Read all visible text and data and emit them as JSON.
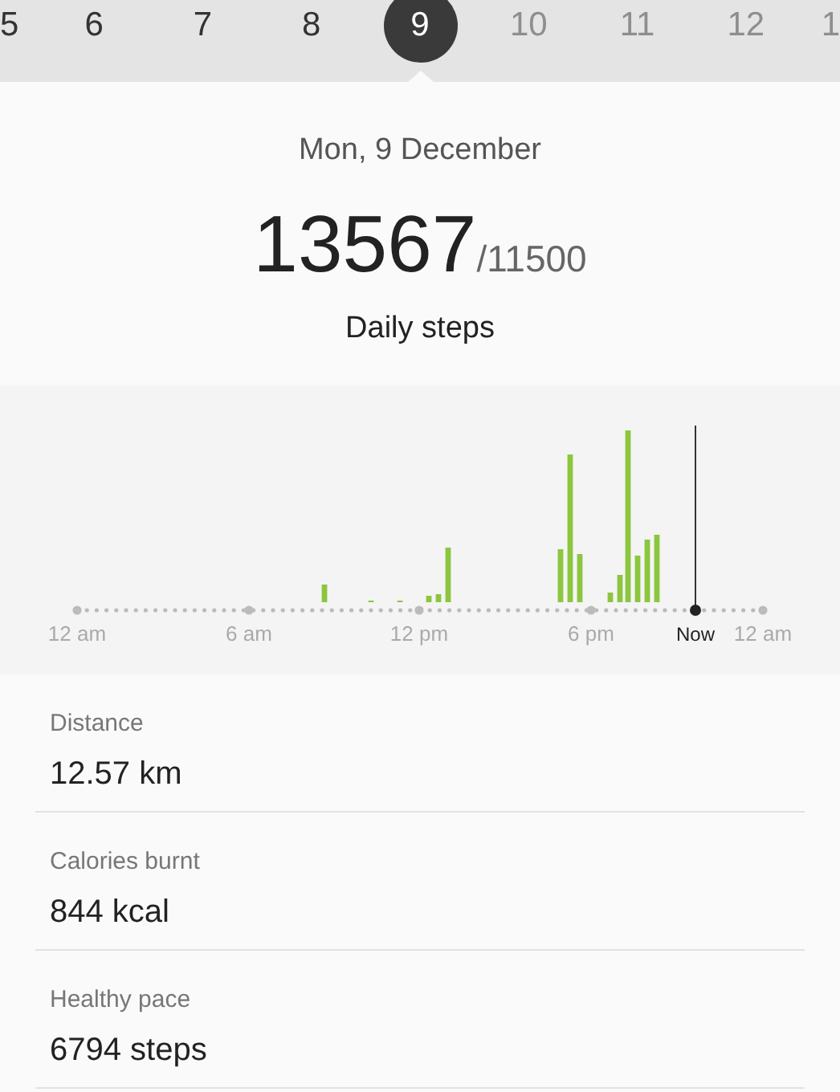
{
  "days": [
    {
      "label": "5",
      "selected": false,
      "disabled": false
    },
    {
      "label": "6",
      "selected": false,
      "disabled": false
    },
    {
      "label": "7",
      "selected": false,
      "disabled": false
    },
    {
      "label": "8",
      "selected": false,
      "disabled": false
    },
    {
      "label": "9",
      "selected": true,
      "disabled": false
    },
    {
      "label": "10",
      "selected": false,
      "disabled": true
    },
    {
      "label": "11",
      "selected": false,
      "disabled": true
    },
    {
      "label": "12",
      "selected": false,
      "disabled": true
    },
    {
      "label": "1",
      "selected": false,
      "disabled": true
    }
  ],
  "summary": {
    "date": "Mon, 9 December",
    "steps": "13567",
    "goal": "/11500",
    "caption": "Daily steps"
  },
  "chart": {
    "axis_labels": [
      "12 am",
      "6 am",
      "12 pm",
      "6 pm",
      "12 am"
    ],
    "now_label": "Now"
  },
  "stats": [
    {
      "label": "Distance",
      "value": "12.57 km"
    },
    {
      "label": "Calories burnt",
      "value": "844 kcal"
    },
    {
      "label": "Healthy pace",
      "value": "6794 steps"
    }
  ]
}
